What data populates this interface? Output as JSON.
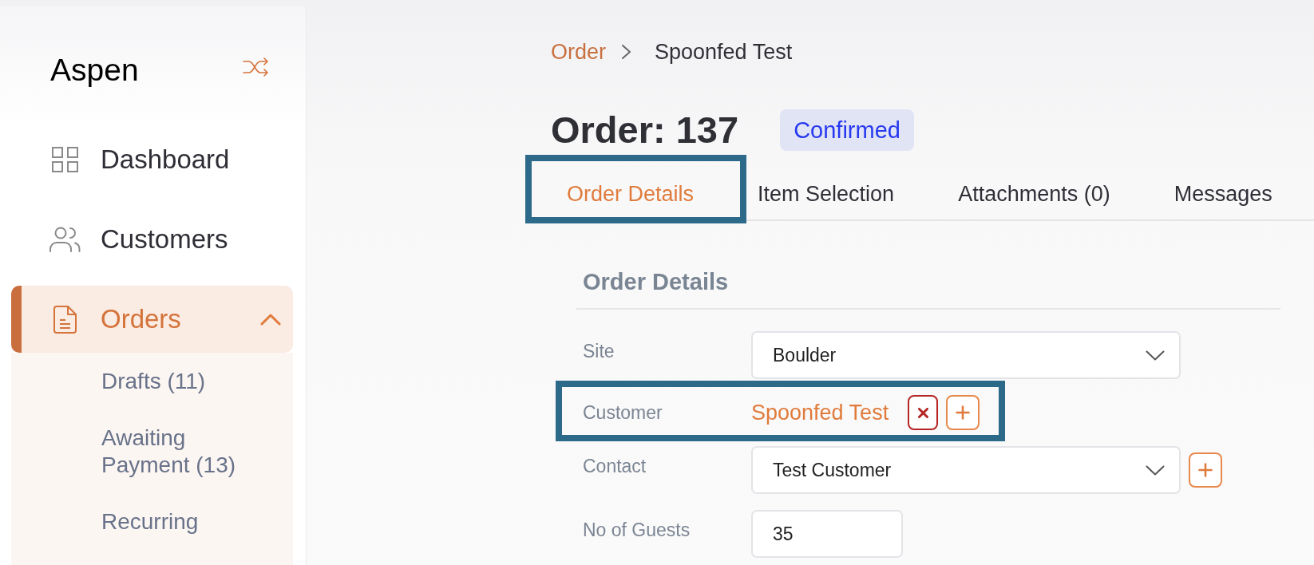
{
  "sidebar": {
    "logo": "Aspen",
    "items": [
      {
        "label": "Dashboard",
        "selected": false
      },
      {
        "label": "Customers",
        "selected": false
      },
      {
        "label": "Orders",
        "selected": true,
        "expanded": true,
        "children": [
          {
            "label": "Drafts (11)",
            "selected": false
          },
          {
            "label": "Awaiting Payment (13)",
            "selected": false
          },
          {
            "label": "Recurring",
            "selected": false
          }
        ]
      }
    ]
  },
  "breadcrumb": [
    {
      "label": "Order"
    },
    {
      "label": "Spoonfed Test"
    }
  ],
  "header": {
    "title": "Order: 137",
    "status": "Confirmed"
  },
  "tabs": [
    {
      "label": "Order Details",
      "selected": true,
      "highlighted": true
    },
    {
      "label": "Item Selection",
      "selected": false,
      "highlighted": false
    },
    {
      "label": "Attachments (0)",
      "selected": false,
      "highlighted": false
    },
    {
      "label": "Messages",
      "selected": false,
      "highlighted": false
    }
  ],
  "section": {
    "title": "Order Details",
    "fields": [
      {
        "kind": "select",
        "label": "Site",
        "value": "Boulder",
        "removable": false,
        "addable": false,
        "highlighted": false
      },
      {
        "kind": "link",
        "label": "Customer",
        "value": "Spoonfed Test",
        "removable": true,
        "addable": true,
        "highlighted": true
      },
      {
        "kind": "select",
        "label": "Contact",
        "value": "Test Customer",
        "removable": false,
        "addable": true,
        "highlighted": false
      },
      {
        "kind": "input",
        "label": "No of Guests",
        "value": "35",
        "removable": false,
        "addable": false,
        "highlighted": false
      }
    ]
  }
}
